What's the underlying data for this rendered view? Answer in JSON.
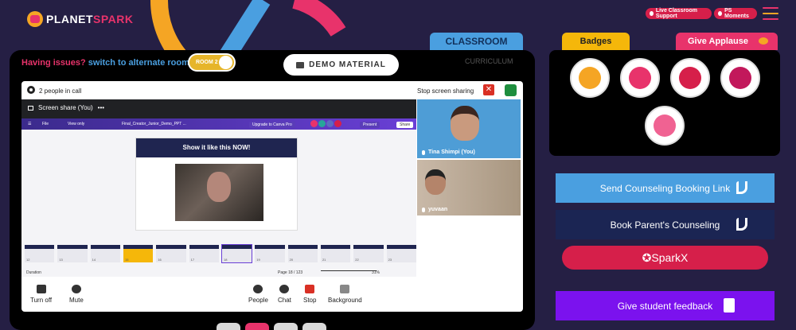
{
  "header": {
    "logo_text_1": "PLANET",
    "logo_text_2": "SPARK",
    "live_support": "Live Classroom Support",
    "ps_moments": "PS Moments"
  },
  "left": {
    "tab_classroom": "CLASSROOM",
    "tab_curriculum": "CURRICULUM",
    "issues_text": "Having issues?",
    "switch_text": "switch to alternate room",
    "room_label": "ROOM 2",
    "demo_material": "DEMO MATERIAL"
  },
  "meet": {
    "people_in_call": "2 people in call",
    "stop_screen_sharing": "Stop screen sharing",
    "screen_share_title": "Screen share (You)",
    "more": "•••",
    "canva": {
      "file": "File",
      "view_only": "View only",
      "doc_title": "Final_Creator_Junior_Demo_PPT ...",
      "upgrade": "Upgrade to Canva Pro",
      "present": "Present",
      "share": "Share",
      "slide_title": "Show it like this NOW!",
      "duration": "Duration",
      "page": "Page 18 / 123",
      "zoom": "31%"
    },
    "thumb_numbers": [
      "12",
      "13",
      "14",
      "15",
      "16",
      "17",
      "18",
      "19",
      "20",
      "21",
      "22",
      "23"
    ],
    "participants": [
      {
        "name": "Tina Shimpi (You)"
      },
      {
        "name": "yuvaan"
      }
    ],
    "controls": {
      "turn_off": "Turn off",
      "mute": "Mute",
      "people": "People",
      "chat": "Chat",
      "stop": "Stop",
      "background": "Background"
    }
  },
  "right": {
    "tab_badges": "Badges",
    "tab_applause": "Give Applause",
    "send_counseling": "Send Counseling Booking Link",
    "book_counseling": "Book Parent's Counseling",
    "sparkx": "SparkX",
    "feedback": "Give student feedback"
  },
  "colors": {
    "background": "#251f44",
    "accent_pink": "#e8336b",
    "accent_blue": "#4a9fe0",
    "accent_yellow": "#f5b70a",
    "accent_purple": "#7b12ee"
  }
}
